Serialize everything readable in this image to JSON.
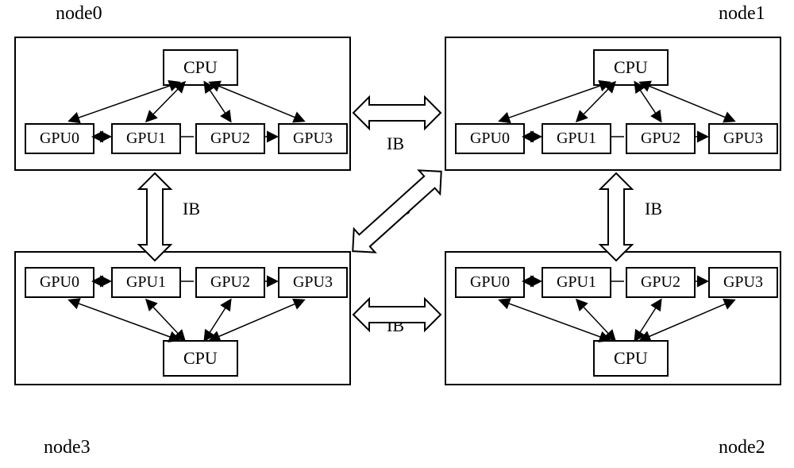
{
  "labels": {
    "node0": "node0",
    "node1": "node1",
    "node2": "node2",
    "node3": "node3"
  },
  "components": {
    "cpu": "CPU",
    "gpu0": "GPU0",
    "gpu1": "GPU1",
    "gpu2": "GPU2",
    "gpu3": "GPU3"
  },
  "interconnect": {
    "ib": "IB"
  },
  "diagram": {
    "description": "Four compute nodes (node0..node3) each containing one CPU and four GPUs (GPU0..GPU3) connected internally; nodes linked pairwise by IB (InfiniBand) interconnects: node0-node1, node0-node3, node1-node2, node3-node2, and a diagonal node0/node1 cross link labeled IB."
  }
}
